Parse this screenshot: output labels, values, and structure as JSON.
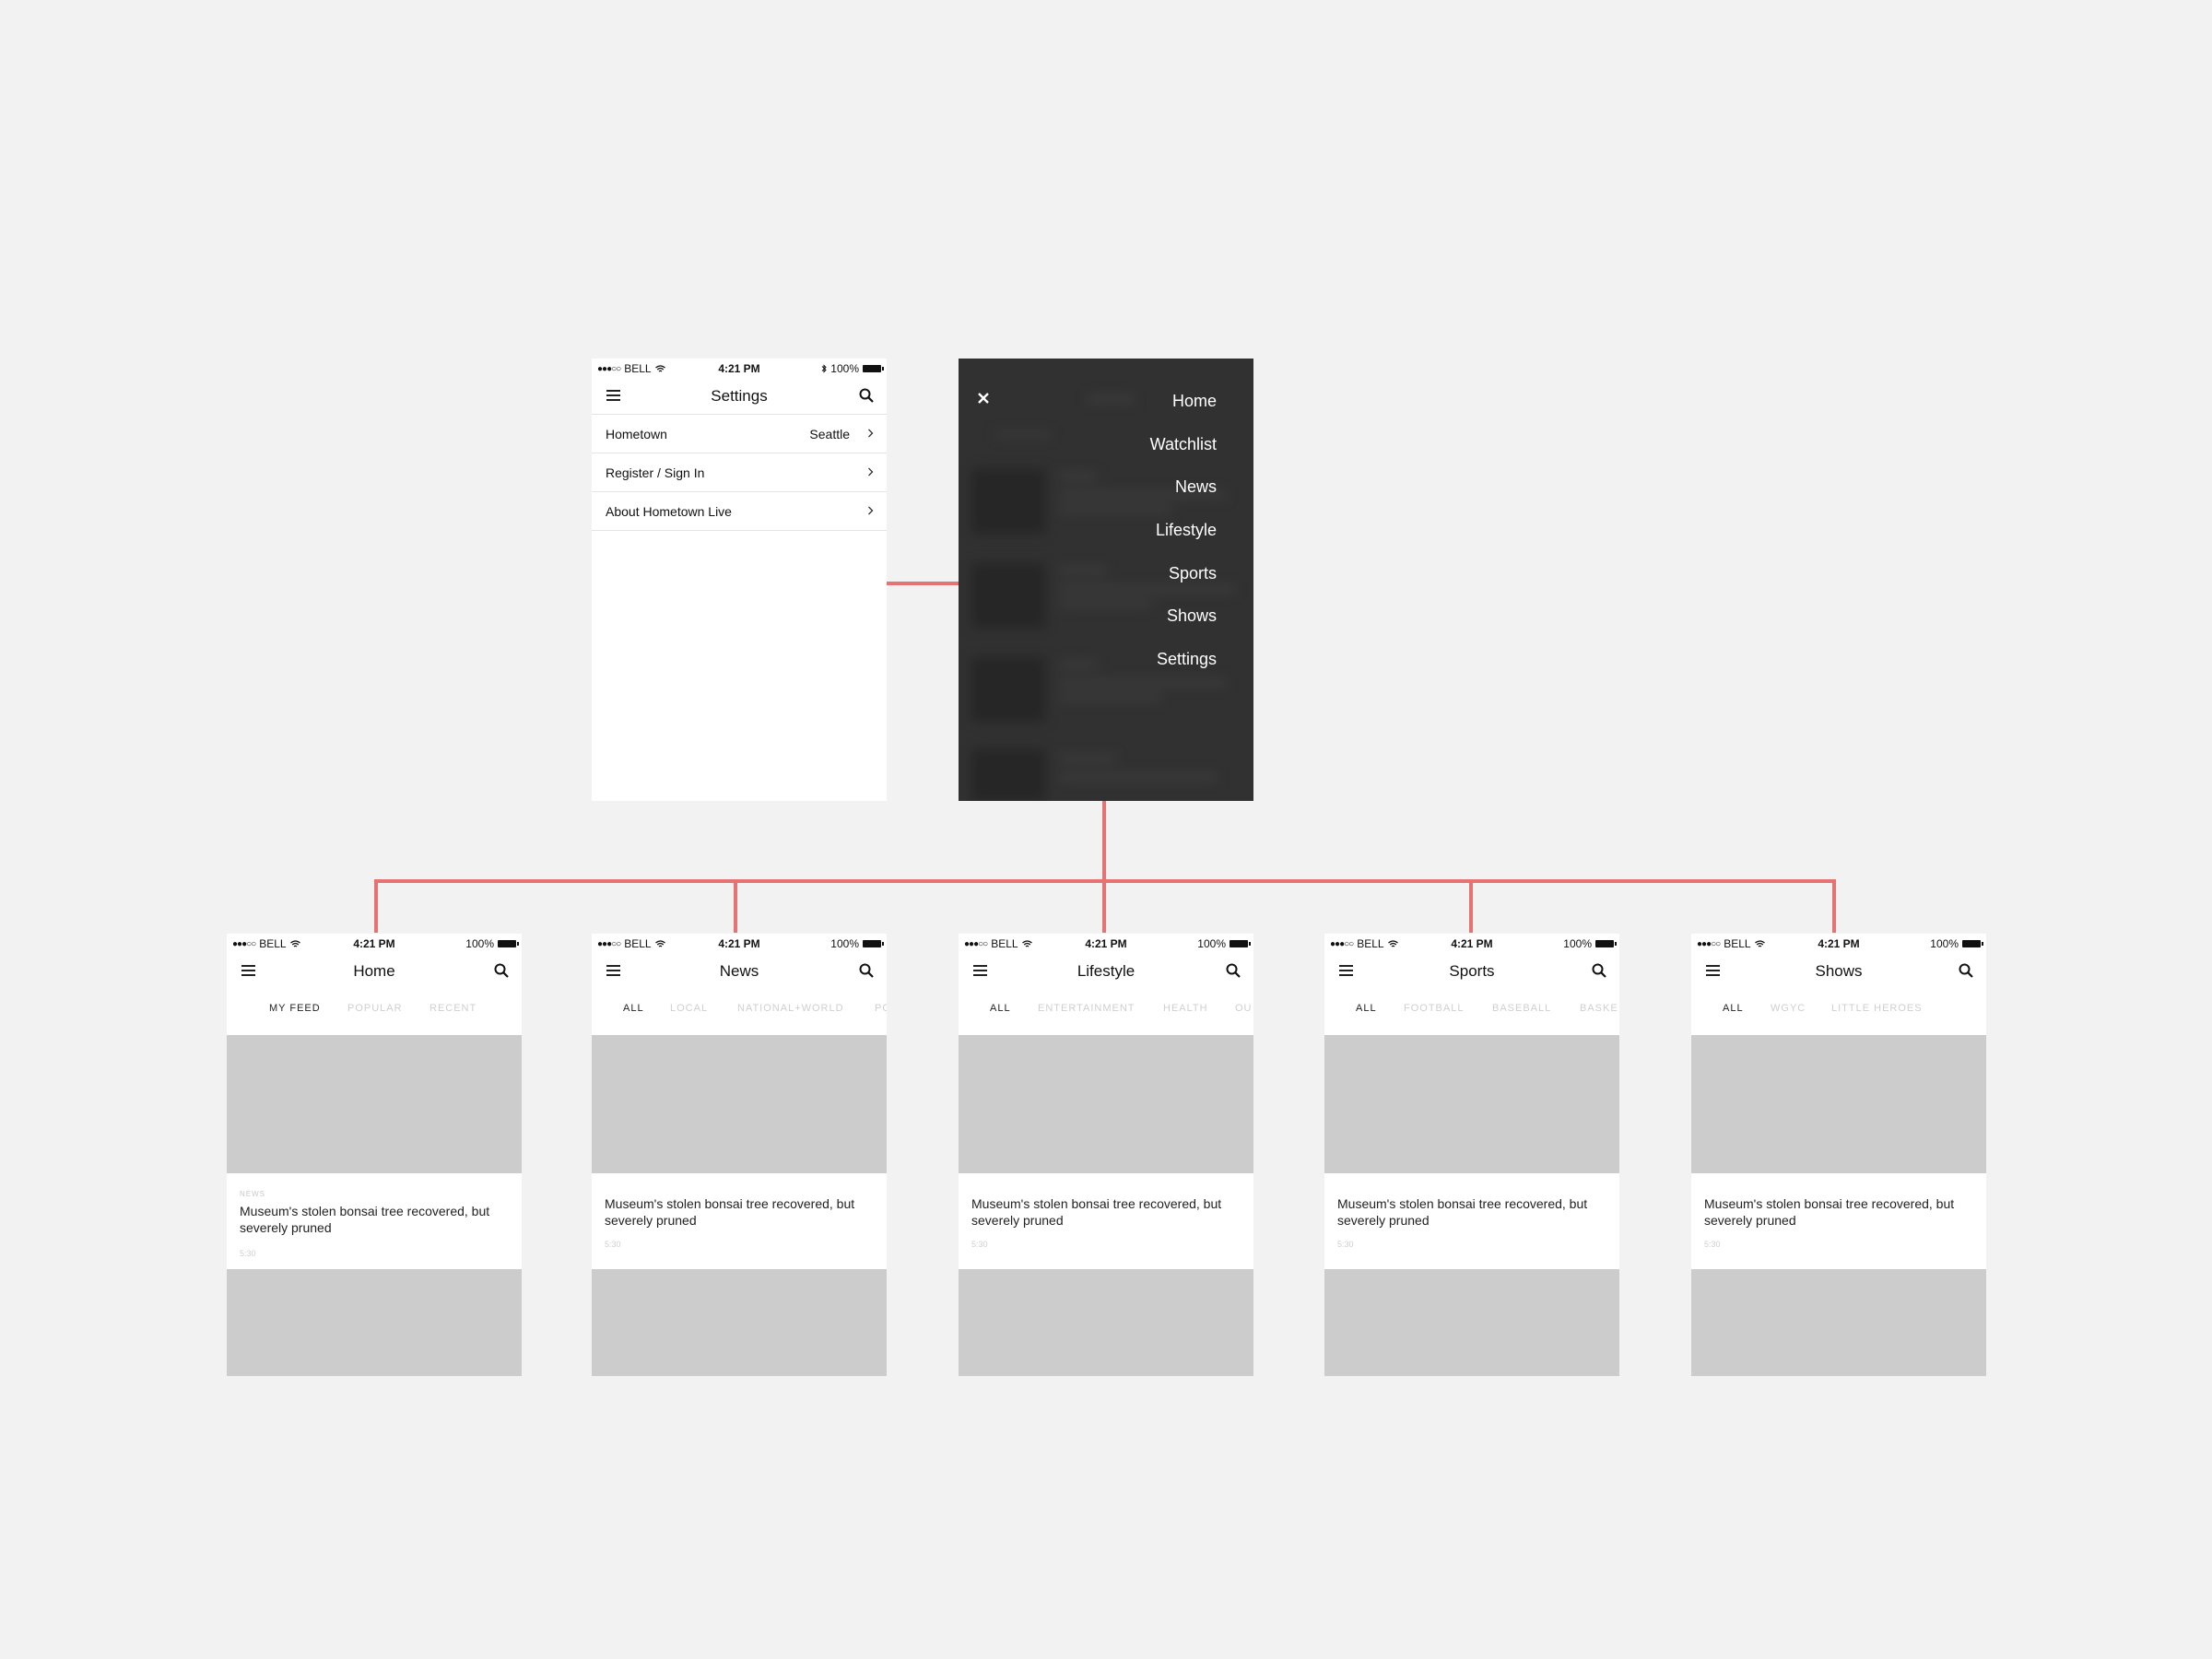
{
  "status": {
    "carrier": "BELL",
    "signal": "●●●○○",
    "time": "4:21 PM",
    "battery": "100%"
  },
  "settings_screen": {
    "title": "Settings",
    "rows": [
      {
        "label": "Hometown",
        "value": "Seattle"
      },
      {
        "label": "Register / Sign In",
        "value": ""
      },
      {
        "label": "About Hometown Live",
        "value": ""
      }
    ]
  },
  "menu_screen": {
    "items": [
      "Home",
      "Watchlist",
      "News",
      "Lifestyle",
      "Sports",
      "Shows",
      "Settings"
    ]
  },
  "story": {
    "headline": "Museum's stolen bonsai tree recovered, but severely pruned",
    "time": "5:30"
  },
  "screens": [
    {
      "title": "Home",
      "category": "NEWS",
      "tabs": [
        "MY FEED",
        "POPULAR",
        "RECENT"
      ]
    },
    {
      "title": "News",
      "category": "",
      "tabs": [
        "ALL",
        "LOCAL",
        "NATIONAL+WORLD",
        "PO"
      ]
    },
    {
      "title": "Lifestyle",
      "category": "",
      "tabs": [
        "ALL",
        "ENTERTAINMENT",
        "HEALTH",
        "OU"
      ]
    },
    {
      "title": "Sports",
      "category": "",
      "tabs": [
        "ALL",
        "FOOTBALL",
        "BASEBALL",
        "BASKE"
      ]
    },
    {
      "title": "Shows",
      "category": "",
      "tabs": [
        "ALL",
        "WGYC",
        "LITTLE HEROES"
      ]
    }
  ],
  "colors": {
    "connector": "#e57373",
    "menu_bg": "#313131",
    "placeholder": "#cccccc",
    "page_bg": "#f2f2f2"
  }
}
